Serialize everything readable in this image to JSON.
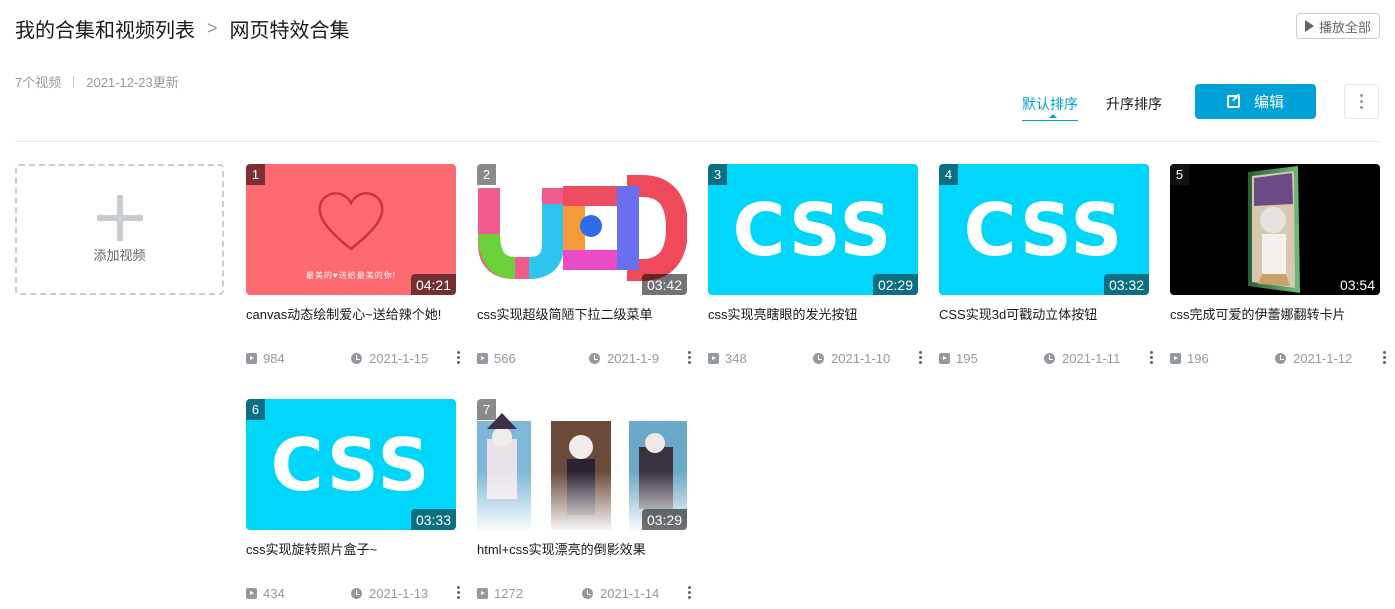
{
  "header": {
    "breadcrumb_root": "我的合集和视频列表",
    "separator": ">",
    "collection_title": "网页特效合集",
    "play_all_label": "播放全部"
  },
  "meta": {
    "video_count": "7个视频",
    "updated": "2021-12-23更新"
  },
  "toolbar": {
    "sort_default": "默认排序",
    "sort_asc": "升序排序",
    "edit_label": "编辑"
  },
  "add_video_label": "添加视频",
  "colors": {
    "accent": "#00a1d6",
    "css_thumb": "#00d5fa",
    "heart_thumb": "#fd6a72"
  },
  "videos": [
    {
      "index": "1",
      "duration": "04:21",
      "title": "canvas动态绘制爱心~送给辣个她!",
      "views": "984",
      "date": "2021-1-15",
      "thumb": "heart"
    },
    {
      "index": "2",
      "duration": "03:42",
      "title": "css实现超级简陋下拉二级菜单",
      "views": "566",
      "date": "2021-1-9",
      "thumb": "ued"
    },
    {
      "index": "3",
      "duration": "02:29",
      "title": "css实现亮瞎眼的发光按钮",
      "views": "348",
      "date": "2021-1-10",
      "thumb": "css"
    },
    {
      "index": "4",
      "duration": "03:32",
      "title": "CSS实现3d可戳动立体按钮",
      "views": "195",
      "date": "2021-1-11",
      "thumb": "css"
    },
    {
      "index": "5",
      "duration": "03:54",
      "title": "css完成可爱的伊蕾娜翻转卡片",
      "views": "196",
      "date": "2021-1-12",
      "thumb": "anime-card"
    },
    {
      "index": "6",
      "duration": "03:33",
      "title": "css实现旋转照片盒子~",
      "views": "434",
      "date": "2021-1-13",
      "thumb": "css"
    },
    {
      "index": "7",
      "duration": "03:29",
      "title": "html+css实现漂亮的倒影效果",
      "views": "1272",
      "date": "2021-1-14",
      "thumb": "anime-reflection"
    }
  ],
  "thumb_text": {
    "css": "CSS",
    "heart_caption": "最美的♥送给最美的你!"
  }
}
